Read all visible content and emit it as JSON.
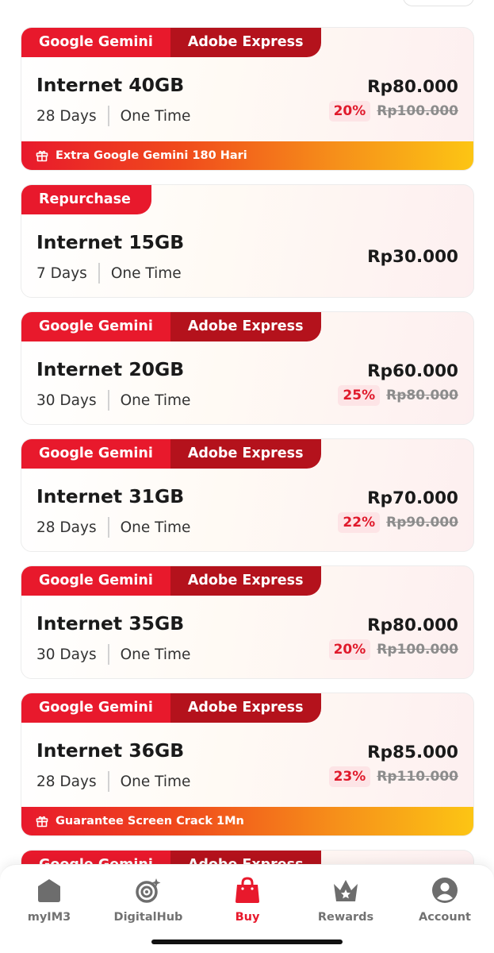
{
  "packages": [
    {
      "tags": [
        "Google Gemini",
        "Adobe Express"
      ],
      "title": "Internet 40GB",
      "days": "28 Days",
      "type": "One Time",
      "price": "Rp80.000",
      "discount": "20%",
      "old_price": "Rp100.000",
      "promo": "Extra Google Gemini 180 Hari"
    },
    {
      "tags": [
        "Repurchase"
      ],
      "title": "Internet 15GB",
      "days": "7 Days",
      "type": "One Time",
      "price": "Rp30.000"
    },
    {
      "tags": [
        "Google Gemini",
        "Adobe Express"
      ],
      "title": "Internet 20GB",
      "days": "30 Days",
      "type": "One Time",
      "price": "Rp60.000",
      "discount": "25%",
      "old_price": "Rp80.000"
    },
    {
      "tags": [
        "Google Gemini",
        "Adobe Express"
      ],
      "title": "Internet 31GB",
      "days": "28 Days",
      "type": "One Time",
      "price": "Rp70.000",
      "discount": "22%",
      "old_price": "Rp90.000"
    },
    {
      "tags": [
        "Google Gemini",
        "Adobe Express"
      ],
      "title": "Internet 35GB",
      "days": "30 Days",
      "type": "One Time",
      "price": "Rp80.000",
      "discount": "20%",
      "old_price": "Rp100.000"
    },
    {
      "tags": [
        "Google Gemini",
        "Adobe Express"
      ],
      "title": "Internet 36GB",
      "days": "28 Days",
      "type": "One Time",
      "price": "Rp85.000",
      "discount": "23%",
      "old_price": "Rp110.000",
      "promo": "Guarantee Screen Crack 1Mn"
    }
  ],
  "partial_card_tags": [
    "Google Gemini",
    "Adobe Express"
  ],
  "nav": {
    "items": [
      {
        "label": "myIM3",
        "icon": "home-icon"
      },
      {
        "label": "DigitalHub",
        "icon": "digitalhub-icon"
      },
      {
        "label": "Buy",
        "icon": "shopping-bag-icon",
        "active": true
      },
      {
        "label": "Rewards",
        "icon": "crown-icon"
      },
      {
        "label": "Account",
        "icon": "account-icon"
      }
    ]
  },
  "colors": {
    "accent": "#e8192c",
    "accent_dark": "#b4121c",
    "promo_end": "#fcc514",
    "nav_inactive": "#727272"
  }
}
